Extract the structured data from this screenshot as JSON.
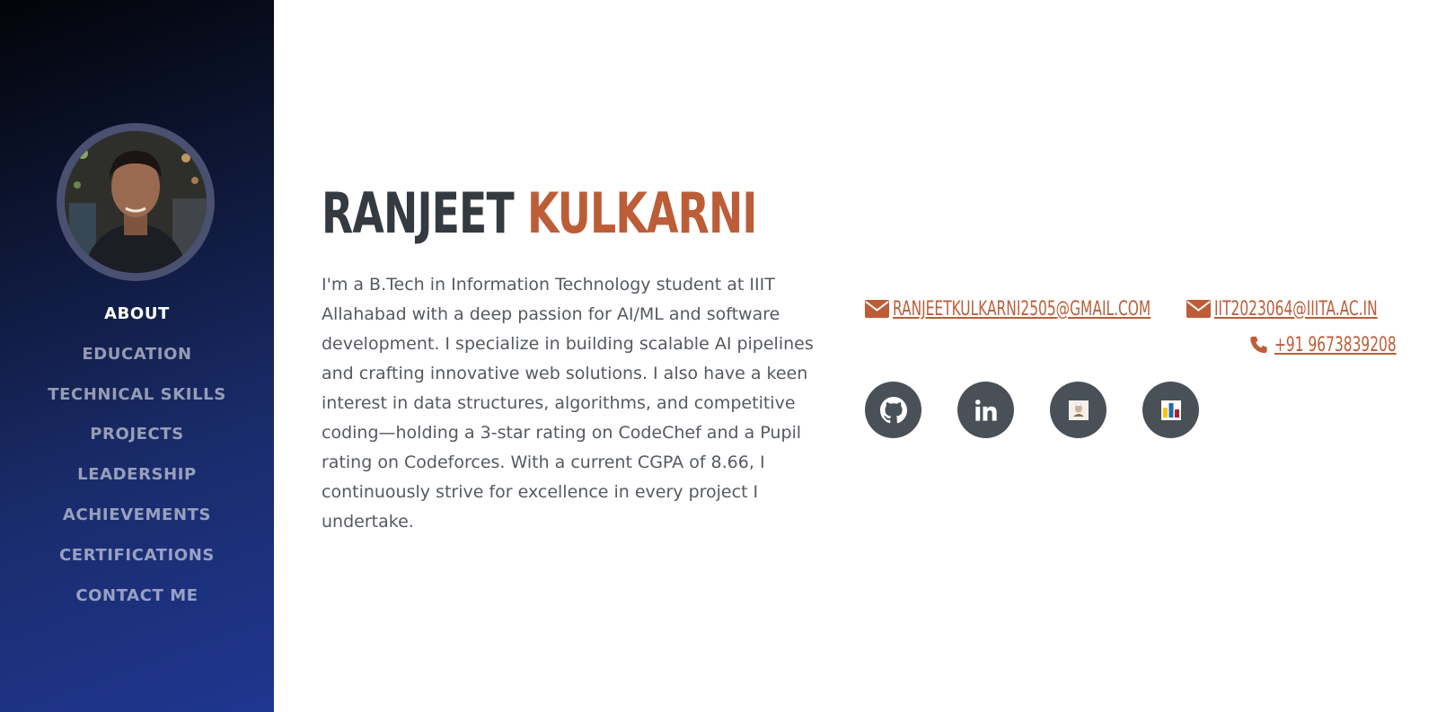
{
  "profile": {
    "first_name": "RANJEET",
    "last_name": "KULKARNI",
    "bio": "I'm a B.Tech in Information Technology student at IIIT Allahabad with a deep passion for AI/ML and software development. I specialize in building scalable AI pipelines and crafting innovative web solutions. I also have a keen interest in data structures, algorithms, and competitive coding—holding a 3-star rating on CodeChef and a Pupil rating on Codeforces. With a current CGPA of 8.66, I continuously strive for excellence in every project I undertake."
  },
  "nav": {
    "items": [
      {
        "label": "ABOUT"
      },
      {
        "label": "EDUCATION"
      },
      {
        "label": "TECHNICAL SKILLS"
      },
      {
        "label": "PROJECTS"
      },
      {
        "label": "LEADERSHIP"
      },
      {
        "label": "ACHIEVEMENTS"
      },
      {
        "label": "CERTIFICATIONS"
      },
      {
        "label": "CONTACT ME"
      }
    ],
    "active": "ABOUT"
  },
  "contact": {
    "email_personal": "RANJEETKULKARNI2505@GMAIL.COM",
    "email_college": "IIT2023064@IIITA.AC.IN",
    "phone": "+91 9673839208"
  },
  "social": [
    {
      "icon": "github-icon"
    },
    {
      "icon": "linkedin-icon"
    },
    {
      "icon": "codechef-icon"
    },
    {
      "icon": "codeforces-icon"
    }
  ],
  "colors": {
    "accent": "#bd5d38",
    "heading": "#343a40",
    "body_text": "#555a60",
    "social_bg": "#495057",
    "sidebar_top": "#030408",
    "sidebar_bottom": "#1f3690"
  }
}
